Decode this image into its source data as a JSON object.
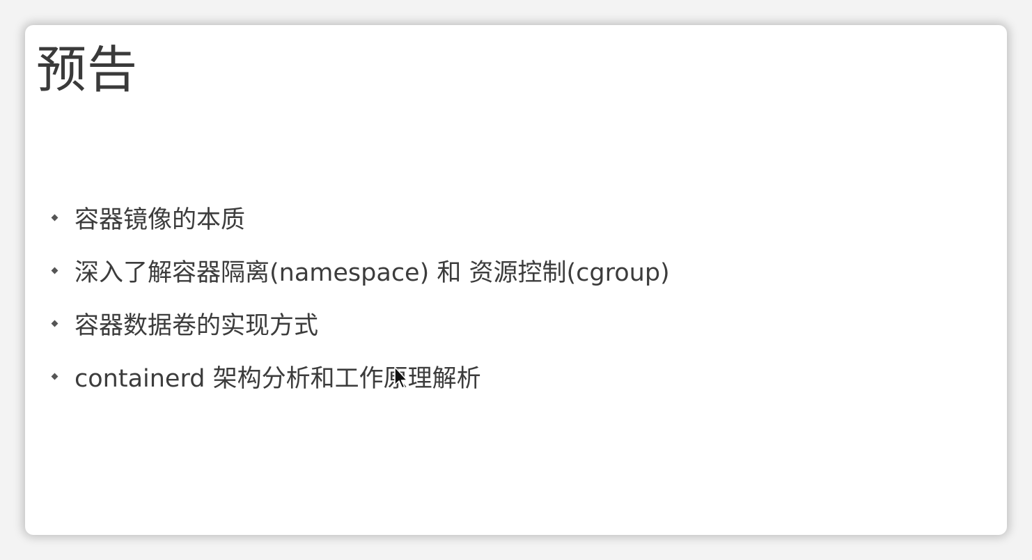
{
  "slide": {
    "title": "预告",
    "bullets": [
      {
        "text": "容器镜像的本质"
      },
      {
        "text": "深入了解容器隔离(namespace) 和 资源控制(cgroup)"
      },
      {
        "text": "容器数据卷的实现方式"
      },
      {
        "text": "containerd 架构分析和工作原理解析"
      }
    ]
  },
  "colors": {
    "background": "#f3f3f3",
    "slide": "#ffffff",
    "text": "#3c3c3c"
  },
  "icons": {
    "cursor": "mouse-pointer-icon",
    "bullet": "diamond-bullet-icon"
  }
}
